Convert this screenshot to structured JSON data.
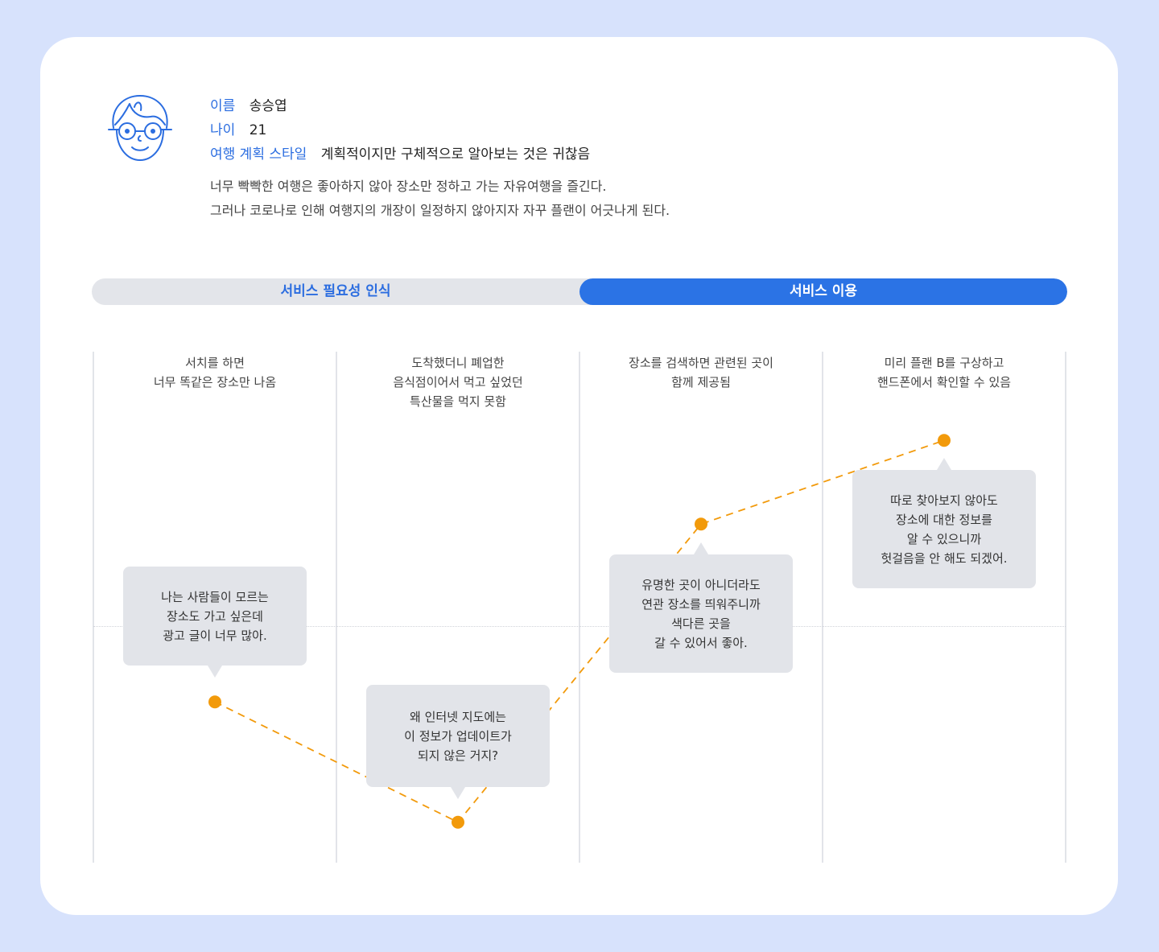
{
  "persona": {
    "avatar_icon": "boy-with-glasses-icon",
    "name_label": "이름",
    "name": "송승엽",
    "age_label": "나이",
    "age": "21",
    "style_label": "여행 계획 스타일",
    "style": "계획적이지만 구체적으로 알아보는 것은 귀찮음",
    "description": [
      "너무 빡빡한 여행은 좋아하지 않아 장소만 정하고 가는 자유여행을 즐긴다.",
      "그러나 코로나로 인해 여행지의 개장이 일정하지 않아지자 자꾸 플랜이 어긋나게 된다."
    ]
  },
  "phases": {
    "phase_1": "서비스 필요성 인식",
    "phase_2": "서비스 이용"
  },
  "colors": {
    "accent": "#2b73e5",
    "point": "#f29a0b",
    "bubble": "#e2e4e9",
    "background": "#d7e2fc"
  },
  "chart_data": {
    "type": "line",
    "steps": [
      {
        "title": "서치를 하면\n너무 똑같은 장소만 나옴",
        "comment": "나는 사람들이 모르는\n장소도 가고 싶은데\n광고 글이 너무 많아.",
        "level": -0.29
      },
      {
        "title": "도착했더니 폐업한\n음식점이어서 먹고 싶었던\n특산물을 먹지 못함",
        "comment": "왜 인터넷 지도에는\n이 정보가 업데이트가\n되지 않은 거지?",
        "level": -0.75
      },
      {
        "title": "장소를 검색하면 관련된 곳이\n함께 제공됨",
        "comment": "유명한 곳이 아니더라도\n연관 장소를 띄워주니까\n색다른 곳을\n갈 수 있어서 좋아.",
        "level": 0.39
      },
      {
        "title": "미리 플랜 B를 구상하고\n핸드폰에서 확인할 수 있음",
        "comment": "따로 찾아보지 않아도\n장소에 대한 정보를\n알 수 있으니까\n헛걸음을 안 해도 되겠어.",
        "level": 0.71
      }
    ]
  }
}
